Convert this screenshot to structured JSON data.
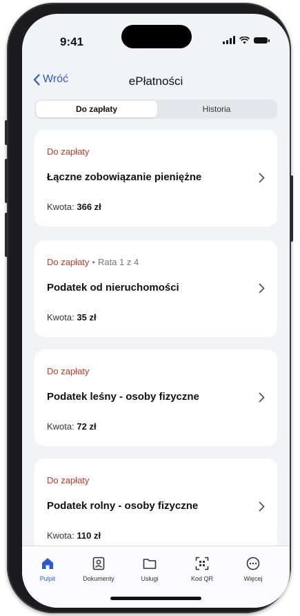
{
  "status_bar": {
    "time": "9:41"
  },
  "nav": {
    "back_label": "Wróć",
    "title": "ePłatności"
  },
  "segmented": {
    "tabs": [
      {
        "label": "Do zapłaty"
      },
      {
        "label": "Historia"
      }
    ],
    "selected": "Do zapłaty"
  },
  "payments": [
    {
      "status": "Do zapłaty",
      "installment": "",
      "title": "Łączne zobowiązanie pieniężne",
      "amount_label": "Kwota:",
      "amount": "366 zł"
    },
    {
      "status": "Do zapłaty",
      "installment": "Rata 1 z 4",
      "title": "Podatek od nieruchomości",
      "amount_label": "Kwota:",
      "amount": "35 zł"
    },
    {
      "status": "Do zapłaty",
      "installment": "",
      "title": "Podatek leśny - osoby fizyczne",
      "amount_label": "Kwota:",
      "amount": "72 zł"
    },
    {
      "status": "Do zapłaty",
      "installment": "",
      "title": "Podatek rolny - osoby fizyczne",
      "amount_label": "Kwota:",
      "amount": "110 zł"
    }
  ],
  "tabbar": {
    "items": [
      {
        "label": "Pulpit",
        "icon": "home-icon",
        "active": true
      },
      {
        "label": "Dokumenty",
        "icon": "id-card-icon",
        "active": false
      },
      {
        "label": "Usługi",
        "icon": "folder-icon",
        "active": false
      },
      {
        "label": "Kod QR",
        "icon": "qr-scan-icon",
        "active": false
      },
      {
        "label": "Więcej",
        "icon": "more-icon",
        "active": false
      }
    ]
  },
  "colors": {
    "accent": "#2a5bd7",
    "status_due": "#c0392b",
    "background": "#f2f3f7"
  }
}
